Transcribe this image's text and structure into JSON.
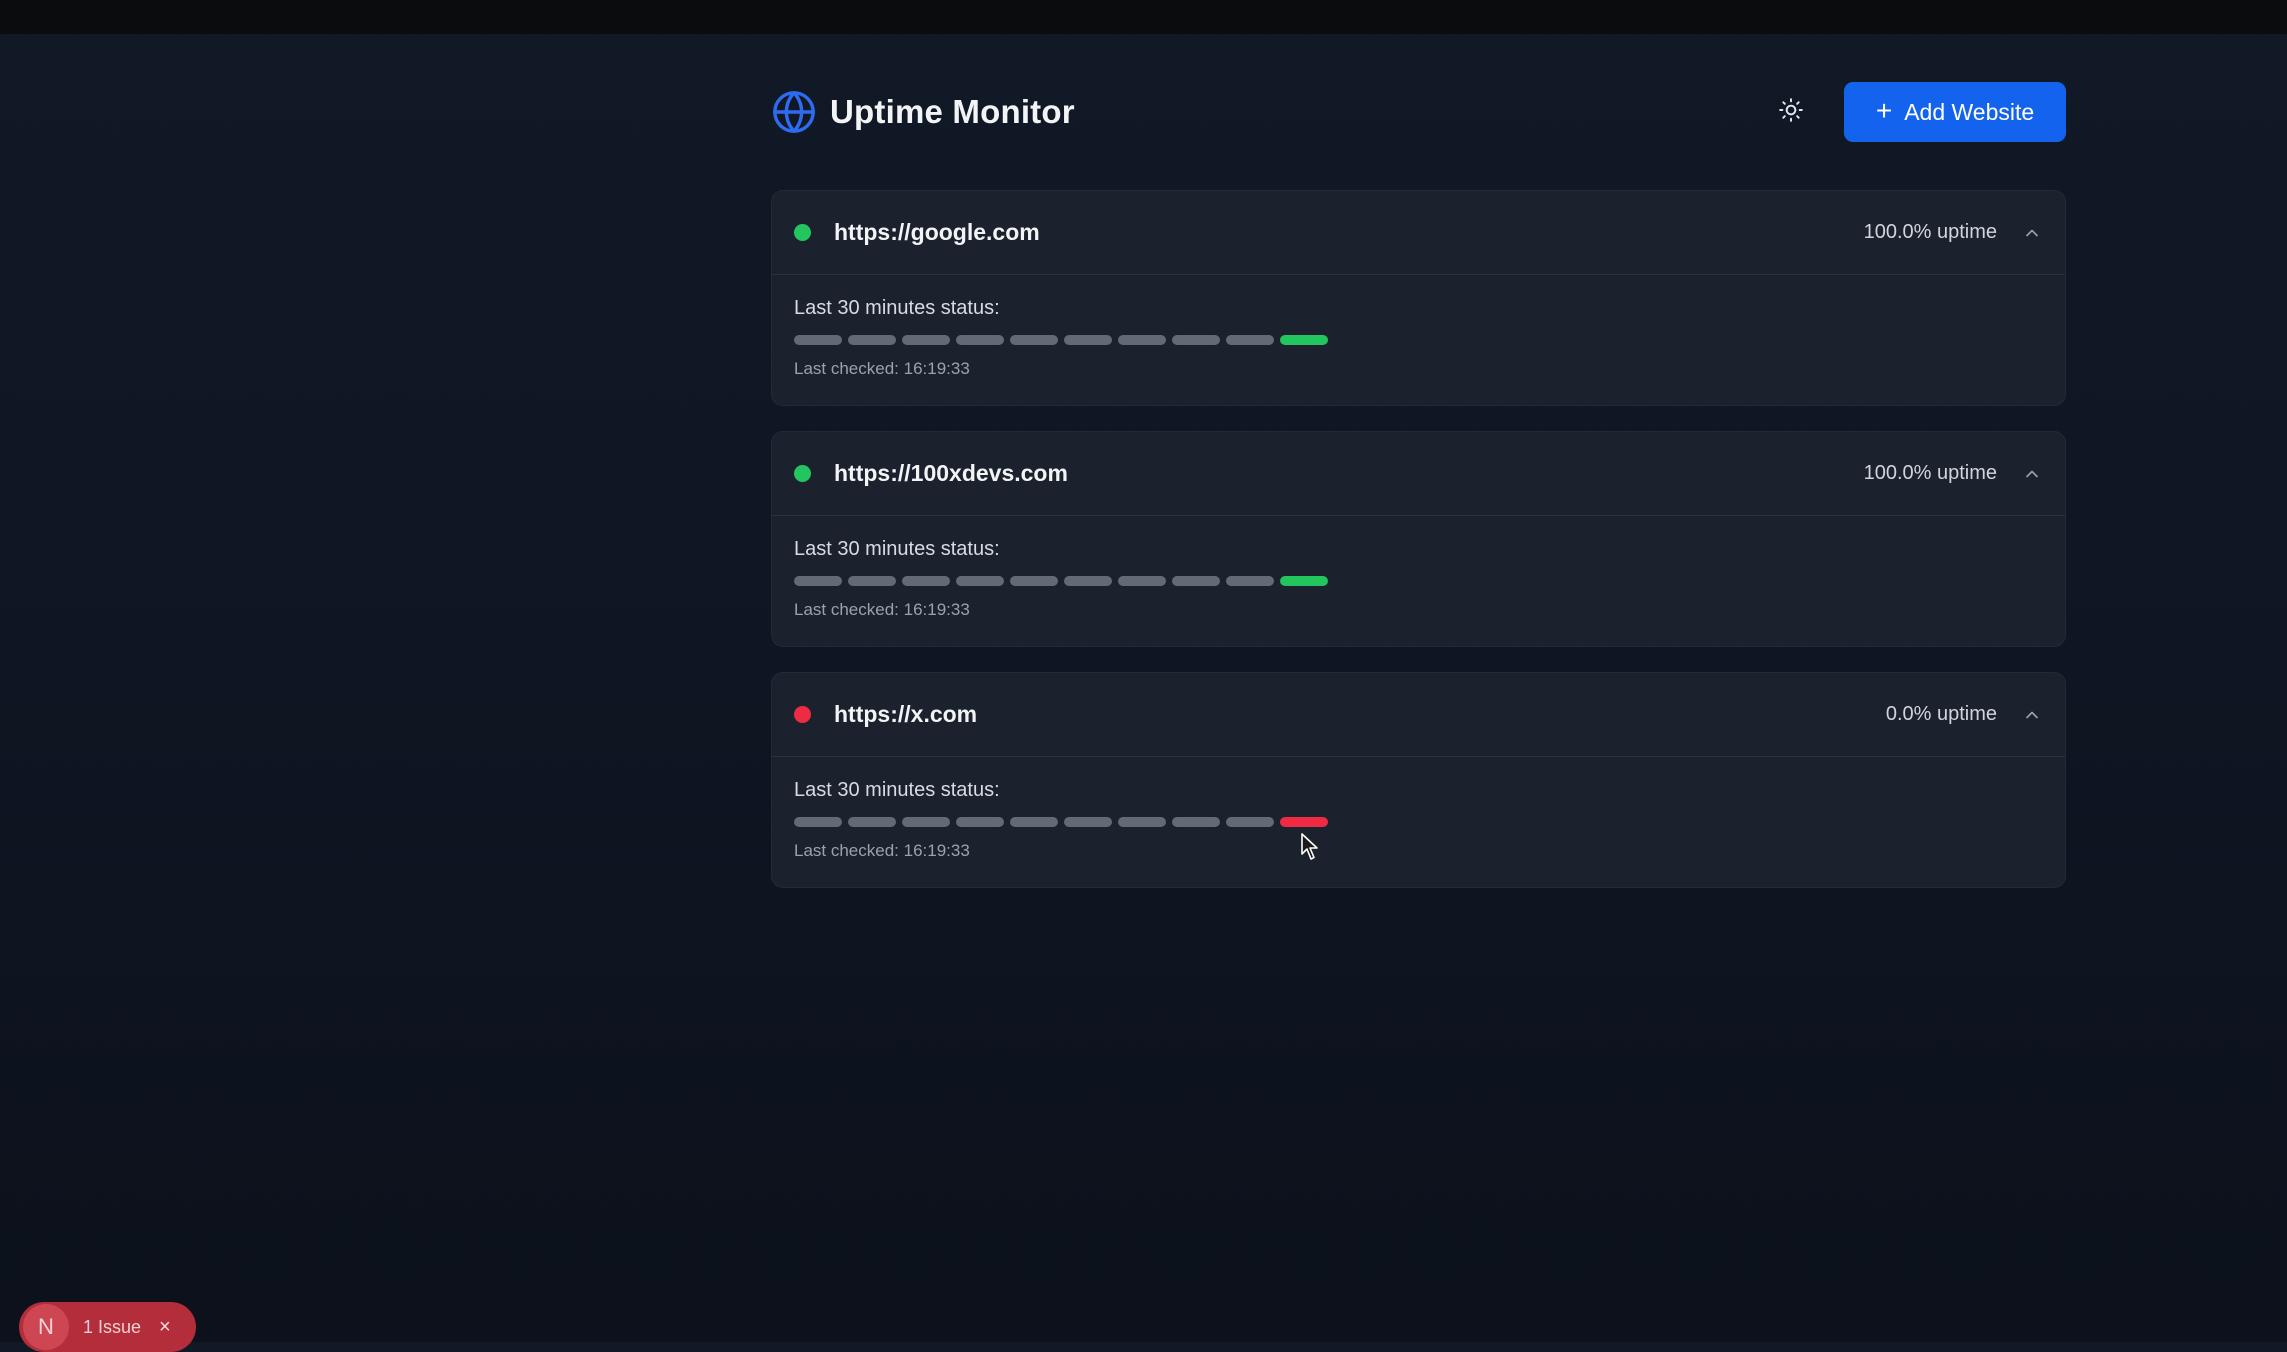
{
  "app": {
    "title": "Uptime Monitor",
    "add_button_label": "Add Website",
    "add_button_icon": "+"
  },
  "colors": {
    "accent": "#1463ee",
    "up": "#22c55e",
    "down": "#ef2b44",
    "inactive": "#636a76"
  },
  "sites": [
    {
      "url": "https://google.com",
      "status": "up",
      "uptime": "100.0% uptime",
      "status_label": "Last 30 minutes status:",
      "history": [
        "none",
        "none",
        "none",
        "none",
        "none",
        "none",
        "none",
        "none",
        "none",
        "up"
      ],
      "last_checked": "Last checked: 16:19:33"
    },
    {
      "url": "https://100xdevs.com",
      "status": "up",
      "uptime": "100.0% uptime",
      "status_label": "Last 30 minutes status:",
      "history": [
        "none",
        "none",
        "none",
        "none",
        "none",
        "none",
        "none",
        "none",
        "none",
        "up"
      ],
      "last_checked": "Last checked: 16:19:33"
    },
    {
      "url": "https://x.com",
      "status": "down",
      "uptime": "0.0% uptime",
      "status_label": "Last 30 minutes status:",
      "history": [
        "none",
        "none",
        "none",
        "none",
        "none",
        "none",
        "none",
        "none",
        "none",
        "down"
      ],
      "last_checked": "Last checked: 16:19:33"
    }
  ],
  "dev_overlay": {
    "badge_letter": "N",
    "issues_label": "1 Issue",
    "close_icon": "×"
  }
}
